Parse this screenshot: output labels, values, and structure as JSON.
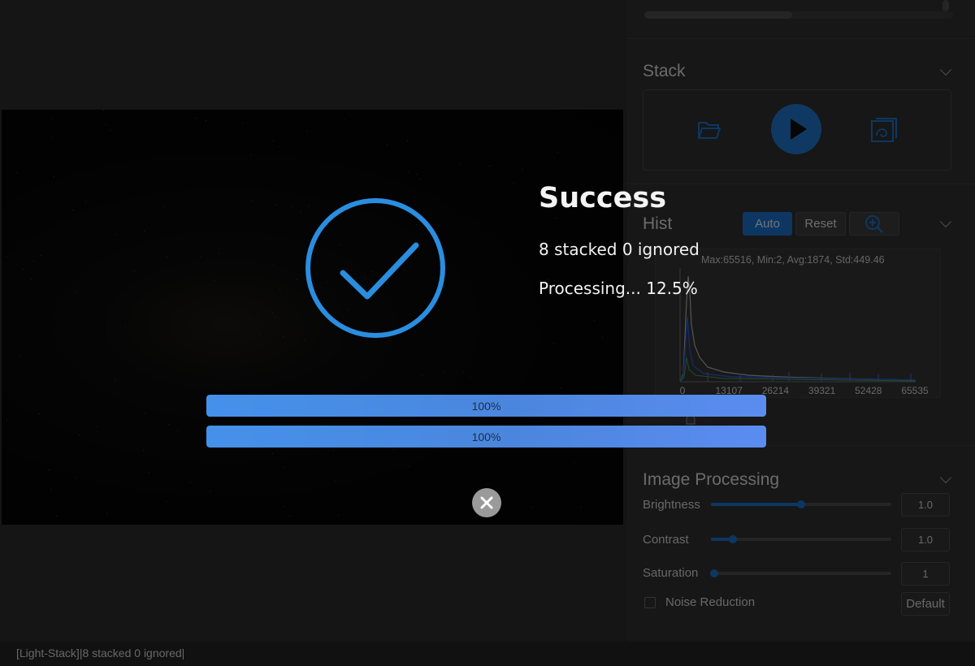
{
  "app": {
    "panel": {
      "stack_section": {
        "title": "Stack"
      },
      "hist_section": {
        "title": "Hist",
        "auto_label": "Auto",
        "reset_label": "Reset",
        "stats": "Max:65516, Min:2, Avg:1874, Std:449.46",
        "x_ticks": [
          "0",
          "13107",
          "26214",
          "39321",
          "52428",
          "65535"
        ]
      },
      "image_processing": {
        "title": "Image Processing",
        "brightness": {
          "label": "Brightness",
          "value": "1.0",
          "level": 0.5
        },
        "contrast": {
          "label": "Contrast",
          "value": "1.0",
          "level": 0.12
        },
        "saturation": {
          "label": "Saturation",
          "value": "1",
          "level": 0.02
        },
        "noise_reduction_label": "Noise Reduction",
        "default_label": "Default"
      }
    },
    "status_bar": {
      "text": "[Light-Stack]|8 stacked 0 ignored|"
    },
    "colors": {
      "accent": "#1a6fc4",
      "progress": "#4a8ce6",
      "check": "#2a8ee0"
    }
  },
  "dialog": {
    "title": "Success",
    "summary": "8 stacked 0 ignored",
    "processing": "Processing... 12.5%",
    "progress_bars": [
      {
        "label": "100%",
        "value": 100
      },
      {
        "label": "100%",
        "value": 100
      }
    ],
    "icons": {
      "status": "check-circle-icon",
      "close": "close-icon"
    }
  }
}
